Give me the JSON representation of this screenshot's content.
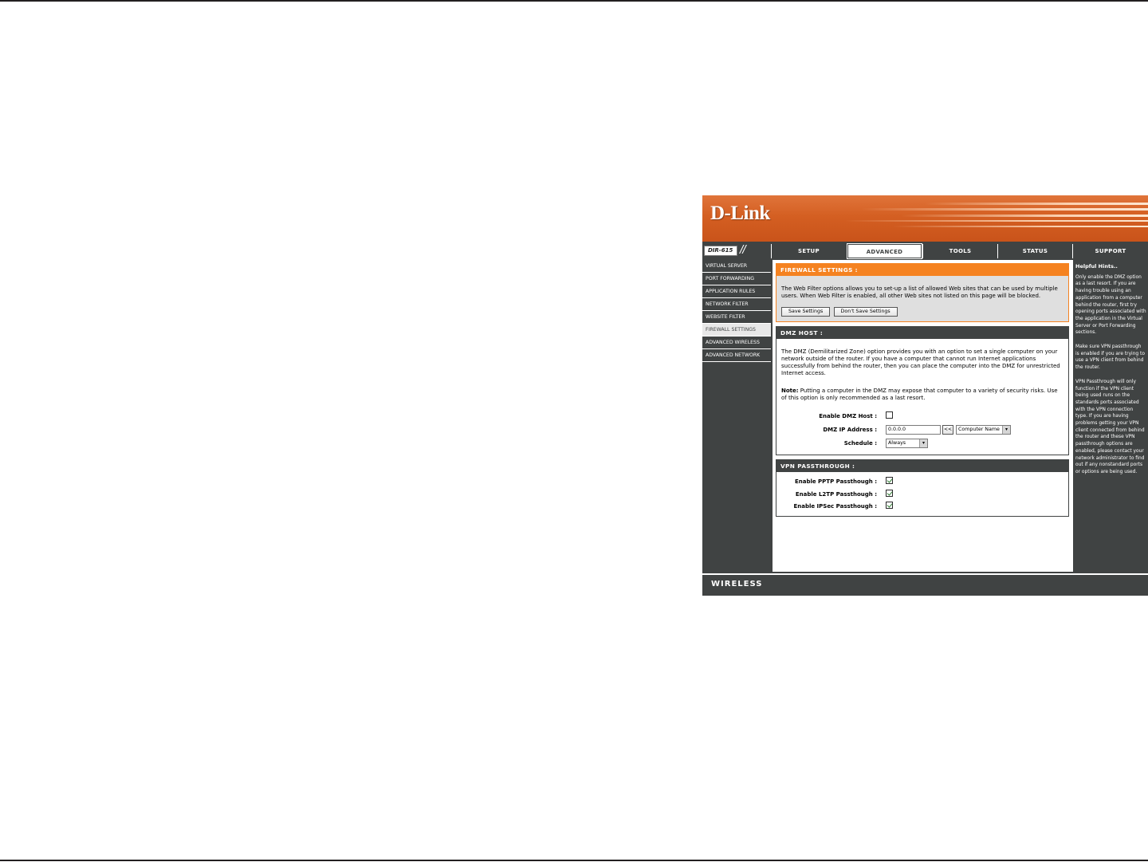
{
  "brand": {
    "logo": "D-Link",
    "model": "DIR-615",
    "footer": "WIRELESS"
  },
  "nav": {
    "tabs": [
      {
        "label": "SETUP"
      },
      {
        "label": "ADVANCED",
        "active": true
      },
      {
        "label": "TOOLS"
      },
      {
        "label": "STATUS"
      },
      {
        "label": "SUPPORT"
      }
    ]
  },
  "sidebar": {
    "items": [
      {
        "label": "VIRTUAL SERVER"
      },
      {
        "label": "PORT FORWARDING"
      },
      {
        "label": "APPLICATION RULES"
      },
      {
        "label": "NETWORK FILTER"
      },
      {
        "label": "WEBSITE FILTER"
      },
      {
        "label": "FIREWALL SETTINGS",
        "active": true
      },
      {
        "label": "ADVANCED WIRELESS"
      },
      {
        "label": "ADVANCED NETWORK"
      }
    ]
  },
  "firewall": {
    "title": "FIREWALL SETTINGS :",
    "description": "The Web Filter options allows you to set-up a list of allowed Web sites that can be used by multiple users. When Web Filter is enabled, all other Web sites not listed on this page will be blocked.",
    "save_label": "Save Settings",
    "dont_save_label": "Don't Save Settings"
  },
  "dmz": {
    "title": "DMZ HOST :",
    "description": "The DMZ (Demilitarized Zone) option provides you with an option to set a single computer on your network outside of the router. If you have a computer that cannot run Internet applications successfully from behind the router, then you can place the computer into the DMZ for unrestricted Internet access.",
    "note_label": "Note:",
    "note_text": " Putting a computer in the DMZ may expose that computer to a variety of security risks. Use of this option is only recommended as a last resort.",
    "enable_label": "Enable DMZ Host :",
    "enable_checked": false,
    "ip_label": "DMZ IP Address :",
    "ip_value": "0.0.0.0",
    "copy_button": "<<",
    "computer_select": "Computer Name",
    "schedule_label": "Schedule :",
    "schedule_value": "Always"
  },
  "vpn": {
    "title": "VPN PASSTHROUGH :",
    "rows": [
      {
        "label": "Enable PPTP Passthough :",
        "checked": true
      },
      {
        "label": "Enable L2TP Passthough :",
        "checked": true
      },
      {
        "label": "Enable IPSec Passthough :",
        "checked": true
      }
    ]
  },
  "help": {
    "title": "Helpful Hints..",
    "paragraphs": [
      "Only enable the DMZ option as a last resort. If you are having trouble using an application from a computer behind the router, first try opening ports associated with the application in the Virtual Server or Port Forwarding sections.",
      "Make sure VPN passthrough is enabled if you are trying to use a VPN client from behind the router.",
      "VPN Passthrough will only function if the VPN client being used runs on the standards ports associated with the VPN connection type. If you are having problems getting your VPN client connected from behind the router and these VPN passthrough options are enabled, please contact your network administrator to find out if any nonstandard ports or options are being used."
    ]
  },
  "colors": {
    "accent": "#f58220",
    "chrome": "#404343",
    "banner": "#d45f22"
  }
}
